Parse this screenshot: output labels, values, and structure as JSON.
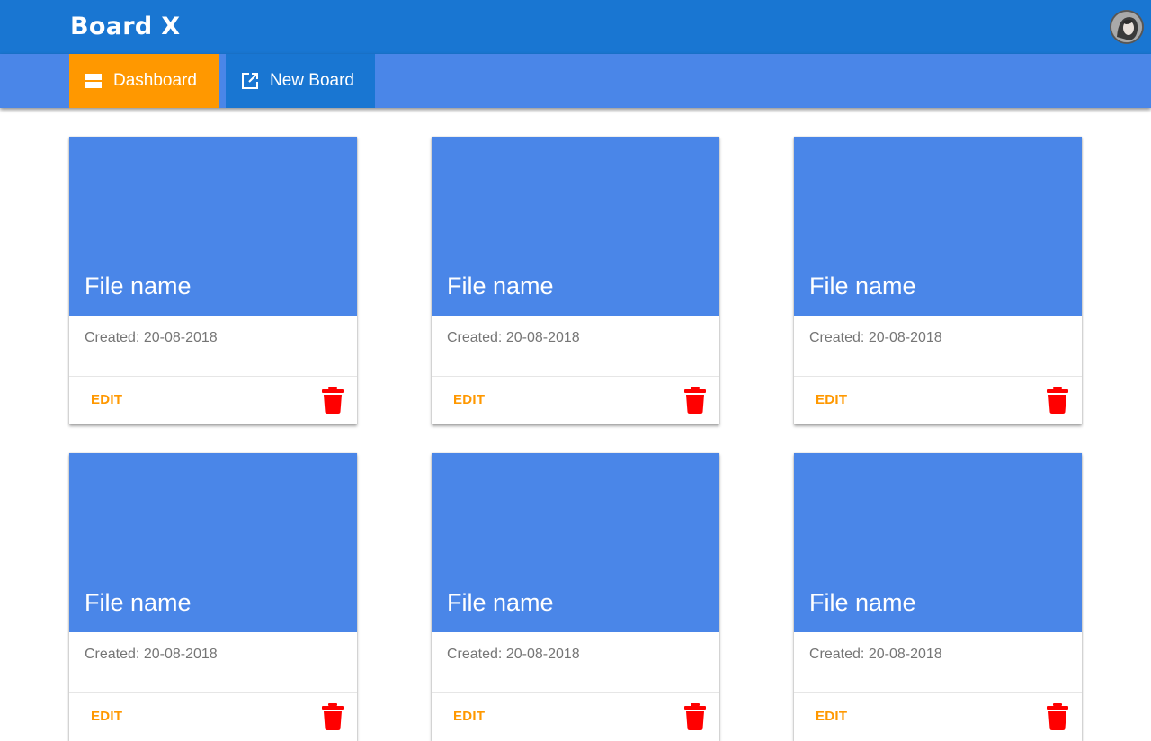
{
  "app": {
    "title": "Board X",
    "colors": {
      "header": "#1976d2",
      "nav": "#4a86e8",
      "active_tab": "#ff9800",
      "card_media": "#4a86e8",
      "edit": "#ff9800",
      "delete": "#ff0000"
    }
  },
  "nav": {
    "tabs": [
      {
        "label": "Dashboard",
        "icon": "dashboard-icon",
        "active": true
      },
      {
        "label": "New Board",
        "icon": "open-in-new-icon",
        "active": false
      }
    ]
  },
  "cards": [
    {
      "title": "File name",
      "created": "Created: 20-08-2018",
      "edit_label": "EDIT",
      "delete_icon": "trash-icon"
    },
    {
      "title": "File name",
      "created": "Created: 20-08-2018",
      "edit_label": "EDIT",
      "delete_icon": "trash-icon"
    },
    {
      "title": "File name",
      "created": "Created: 20-08-2018",
      "edit_label": "EDIT",
      "delete_icon": "trash-icon"
    },
    {
      "title": "File name",
      "created": "Created: 20-08-2018",
      "edit_label": "EDIT",
      "delete_icon": "trash-icon"
    },
    {
      "title": "File name",
      "created": "Created: 20-08-2018",
      "edit_label": "EDIT",
      "delete_icon": "trash-icon"
    },
    {
      "title": "File name",
      "created": "Created: 20-08-2018",
      "edit_label": "EDIT",
      "delete_icon": "trash-icon"
    }
  ]
}
